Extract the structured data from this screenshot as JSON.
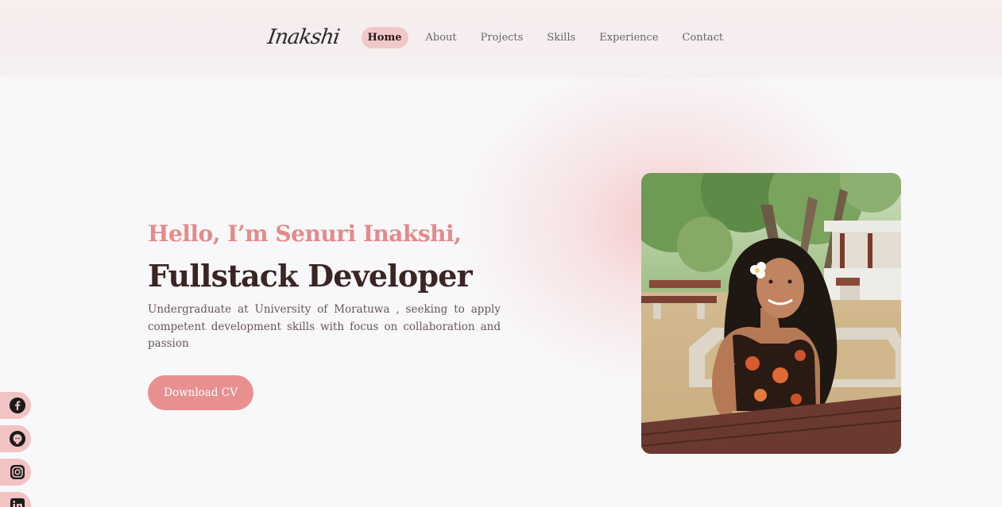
{
  "header": {
    "logo_text": "Inakshi",
    "nav": [
      {
        "label": "Home",
        "active": true
      },
      {
        "label": "About"
      },
      {
        "label": "Projects"
      },
      {
        "label": "Skills"
      },
      {
        "label": "Experience"
      },
      {
        "label": "Contact"
      }
    ]
  },
  "hero": {
    "greeting": "Hello, I’m Senuri Inakshi,",
    "role": "Fullstack Developer",
    "description": "Undergraduate at University of Moratuwa , seeking to apply competent development skills with focus on collaboration and passion",
    "cta_label": "Download CV"
  },
  "socials": [
    {
      "icon": "facebook-icon"
    },
    {
      "icon": "github-icon"
    },
    {
      "icon": "instagram-icon"
    },
    {
      "icon": "linkedin-icon"
    }
  ],
  "colors": {
    "accent": "#e89090",
    "greeting": "#e58a8a",
    "heading": "#3b2424",
    "nav_active_bg": "#f1c8c8"
  }
}
